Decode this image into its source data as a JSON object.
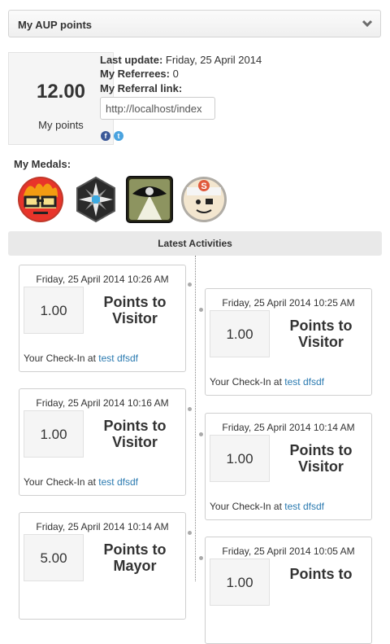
{
  "header": {
    "title": "My AUP points",
    "chevron_icon": "chevron-down-icon"
  },
  "points": {
    "value": "12.00",
    "label": "My points"
  },
  "info": {
    "last_update_label": "Last update:",
    "last_update_value": "Friday, 25 April 2014",
    "referrees_label": "My Referrees:",
    "referrees_value": "0",
    "referral_label": "My Referral link:",
    "referral_value": "http://localhost/index"
  },
  "social": {
    "facebook_glyph": "f",
    "twitter_glyph": "t"
  },
  "medals": {
    "title": "My Medals:",
    "items": [
      "angry-face-medal-icon",
      "compass-star-medal-icon",
      "eye-road-medal-icon",
      "sailor-face-medal-icon"
    ]
  },
  "activities": {
    "title": "Latest Activities",
    "items": [
      {
        "date": "Friday, 25 April 2014 10:26 AM",
        "value": "1.00",
        "title_line1": "Points to",
        "title_line2": "Visitor",
        "foot_text": "Your Check-In at",
        "foot_link": "test dfsdf"
      },
      {
        "date": "Friday, 25 April 2014 10:25 AM",
        "value": "1.00",
        "title_line1": "Points to",
        "title_line2": "Visitor",
        "foot_text": "Your Check-In at",
        "foot_link": "test dfsdf"
      },
      {
        "date": "Friday, 25 April 2014 10:16 AM",
        "value": "1.00",
        "title_line1": "Points to",
        "title_line2": "Visitor",
        "foot_text": "Your Check-In at",
        "foot_link": "test dfsdf"
      },
      {
        "date": "Friday, 25 April 2014 10:14 AM",
        "value": "1.00",
        "title_line1": "Points to",
        "title_line2": "Visitor",
        "foot_text": "Your Check-In at",
        "foot_link": "test dfsdf"
      },
      {
        "date": "Friday, 25 April 2014 10:14 AM",
        "value": "5.00",
        "title_line1": "Points to",
        "title_line2": "Mayor",
        "foot_text": "",
        "foot_link": ""
      },
      {
        "date": "Friday, 25 April 2014 10:05 AM",
        "value": "1.00",
        "title_line1": "Points to",
        "title_line2": "",
        "foot_text": "",
        "foot_link": ""
      }
    ]
  }
}
